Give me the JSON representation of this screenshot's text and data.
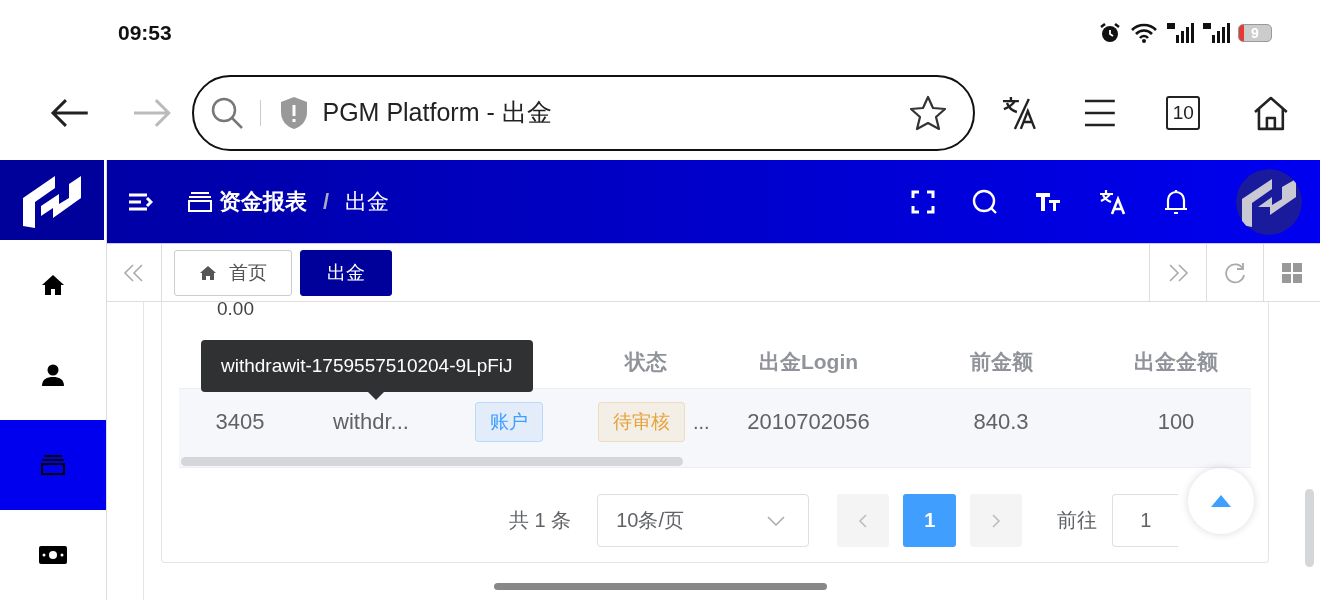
{
  "status_bar": {
    "time": "09:53",
    "battery": "9"
  },
  "browser": {
    "address": "PGM Platform - 出金",
    "tab_count": "10"
  },
  "header": {
    "breadcrumb": [
      "资金报表",
      "出金"
    ],
    "separator": "/"
  },
  "sidebar": {
    "items": [
      {
        "kind": "home",
        "selected": false
      },
      {
        "kind": "user",
        "selected": false
      },
      {
        "kind": "cards",
        "selected": true
      },
      {
        "kind": "money",
        "selected": false
      }
    ]
  },
  "tabs": [
    {
      "label": "首页",
      "kind": "home",
      "selected": false
    },
    {
      "label": "出金",
      "kind": "plain",
      "selected": true
    }
  ],
  "content": {
    "summary_value": "0.00",
    "tooltip": "withdrawit-1759557510204-9LpFiJ",
    "table": {
      "columns": [
        "",
        "",
        "",
        "状态",
        "出金Login",
        "前金额",
        "出金金额"
      ],
      "rows": [
        {
          "cells": [
            {
              "kind": "text",
              "text": "3405"
            },
            {
              "kind": "text",
              "text": "withdr..."
            },
            {
              "kind": "tag",
              "text": "账户",
              "color": "#409eff"
            },
            {
              "kind": "tag",
              "text": "待审核",
              "color": "#e6a23c",
              "overflow": "..."
            },
            {
              "kind": "text",
              "text": "2010702056"
            },
            {
              "kind": "text",
              "text": "840.3"
            },
            {
              "kind": "text",
              "text": "100"
            }
          ]
        }
      ]
    },
    "pagination": {
      "total": "共 1 条",
      "page_size": "10条/页",
      "pages": [
        {
          "label": "1",
          "selected": true
        }
      ],
      "goto_label": "前往",
      "goto_value": "1"
    }
  }
}
